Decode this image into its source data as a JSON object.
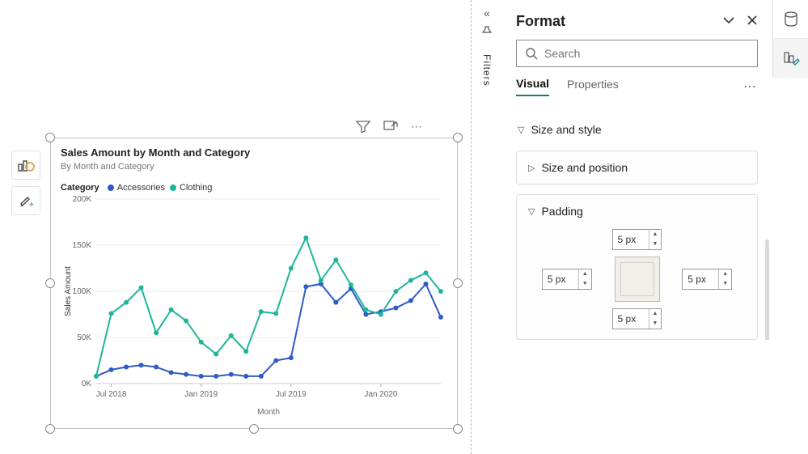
{
  "left_toolbar": {
    "chart_icon": "chart-types-icon",
    "brush_icon": "format-brush-icon"
  },
  "visual_header": {
    "filter": "filter-icon",
    "focus": "focus-mode-icon",
    "more": "⋯"
  },
  "filters_rail": {
    "collapse": "«",
    "label": "Filters",
    "speaker": "filters-audio-icon"
  },
  "right_icons": {
    "data": "data-pane-icon",
    "brush": "format-pane-icon"
  },
  "format_pane": {
    "title": "Format",
    "header_icons": {
      "expand": "expand-icon",
      "close": "close-icon"
    },
    "search_placeholder": "Search",
    "tabs": {
      "visual": "Visual",
      "properties": "Properties",
      "more": "⋯"
    },
    "sections": {
      "size_style": "Size and style",
      "size_position": "Size and position",
      "padding": "Padding"
    },
    "padding_values": {
      "top": "5 px",
      "left": "5 px",
      "right": "5 px",
      "bottom": "5 px"
    }
  },
  "chart_data": {
    "type": "line",
    "title": "Sales Amount by Month and Category",
    "subtitle": "By Month and Category",
    "legend_title": "Category",
    "xlabel": "Month",
    "ylabel": "Sales Amount",
    "ylim": [
      0,
      200000
    ],
    "y_ticks": [
      0,
      50000,
      100000,
      150000,
      200000
    ],
    "y_tick_labels": [
      "0K",
      "50K",
      "100K",
      "150K",
      "200K"
    ],
    "x_tick_labels": [
      "Jul 2018",
      "Jan 2019",
      "Jul 2019",
      "Jan 2020"
    ],
    "x_tick_indices": [
      1,
      7,
      13,
      19
    ],
    "categories": [
      "Jun 2018",
      "Jul 2018",
      "Aug 2018",
      "Sep 2018",
      "Oct 2018",
      "Nov 2018",
      "Dec 2018",
      "Jan 2019",
      "Feb 2019",
      "Mar 2019",
      "Apr 2019",
      "May 2019",
      "Jun 2019",
      "Jul 2019",
      "Aug 2019",
      "Sep 2019",
      "Oct 2019",
      "Nov 2019",
      "Dec 2019",
      "Jan 2020",
      "Feb 2020",
      "Mar 2020",
      "Apr 2020",
      "May 2020"
    ],
    "series": [
      {
        "name": "Accessories",
        "color": "#2f5bc4",
        "values": [
          8000,
          15000,
          18000,
          20000,
          18000,
          12000,
          10000,
          8000,
          8000,
          10000,
          8000,
          8000,
          25000,
          28000,
          105000,
          108000,
          88000,
          103000,
          75000,
          78000,
          82000,
          90000,
          108000,
          72000
        ]
      },
      {
        "name": "Clothing",
        "color": "#1fb59a",
        "values": [
          8000,
          76000,
          88000,
          104000,
          55000,
          80000,
          68000,
          45000,
          32000,
          52000,
          35000,
          78000,
          76000,
          125000,
          158000,
          112000,
          134000,
          107000,
          80000,
          75000,
          100000,
          112000,
          120000,
          100000
        ]
      }
    ]
  }
}
